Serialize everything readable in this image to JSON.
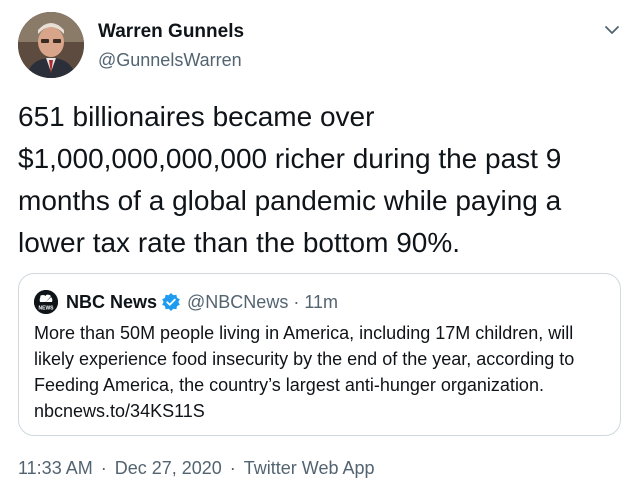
{
  "author": {
    "name": "Warren Gunnels",
    "handle": "@GunnelsWarren"
  },
  "tweet": {
    "text": "651 billionaires became over $1,000,000,000,000 richer during the past 9 months of a global pandemic while paying a lower tax rate than the bottom 90%."
  },
  "quoted_tweet": {
    "name": "NBC News",
    "logo_text": "NEWS",
    "handle": "@NBCNews",
    "separator": "·",
    "time": "11m",
    "text": "More than 50M people living in America, including 17M children, will likely experience food insecurity by the end of the year, according to Feeding America, the country’s largest anti-hunger organization. nbcnews.to/34KS11S"
  },
  "footer": {
    "time": "11:33 AM",
    "separator": "·",
    "date": "Dec 27, 2020",
    "app": "Twitter Web App"
  },
  "icons": {
    "caret": "chevron-down-icon",
    "verified": "verified-badge-icon",
    "logo": "nbc-peacock-logo"
  },
  "colors": {
    "verified": "#1d9bf0",
    "secondary_text": "#536471",
    "border": "#cfd9de"
  }
}
